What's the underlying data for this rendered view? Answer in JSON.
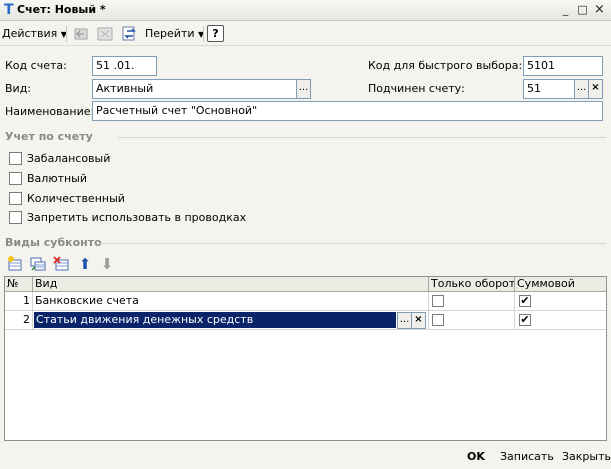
{
  "window": {
    "title": "Счет: Новый *",
    "app_glyph": "T",
    "min": "_",
    "max": "□",
    "close": "×"
  },
  "toolbar": {
    "actions_label": "Действия",
    "goto_label": "Перейти",
    "help_label": "?"
  },
  "form": {
    "code_label": "Код счета:",
    "code_value": "51 .01.",
    "quick_code_label": "Код для быстрого выбора:",
    "quick_code_value": "5101",
    "kind_label": "Вид:",
    "kind_value": "Активный",
    "parent_label": "Подчинен счету:",
    "parent_value": "51",
    "name_label": "Наименование:",
    "name_value": "Расчетный счет \"Основной\""
  },
  "accounting": {
    "section_title": "Учет по счету",
    "checkboxes": [
      {
        "label": "Забалансовый",
        "checked": false
      },
      {
        "label": "Валютный",
        "checked": false
      },
      {
        "label": "Количественный",
        "checked": false
      },
      {
        "label": "Запретить использовать в проводках",
        "checked": false
      }
    ]
  },
  "subconto": {
    "section_title": "Виды субконто",
    "columns": {
      "num": "№",
      "kind": "Вид",
      "turnover": "Только обороты",
      "sum": "Суммовой"
    },
    "rows": [
      {
        "num": "1",
        "kind": "Банковские счета",
        "turnover_only": false,
        "sum": true
      },
      {
        "num": "2",
        "kind": "Статьи движения денежных средств",
        "turnover_only": false,
        "sum": true
      }
    ]
  },
  "footer": {
    "ok": "OK",
    "save": "Записать",
    "close": "Закрыть"
  },
  "glyphs": {
    "ellipsis": "...",
    "clear": "×",
    "check": "✔",
    "arrow_up": "⬆",
    "arrow_down": "⬇"
  },
  "colors": {
    "accent": "#2a6bc9",
    "selection": "#0a246a",
    "section": "#8a8a8a"
  }
}
